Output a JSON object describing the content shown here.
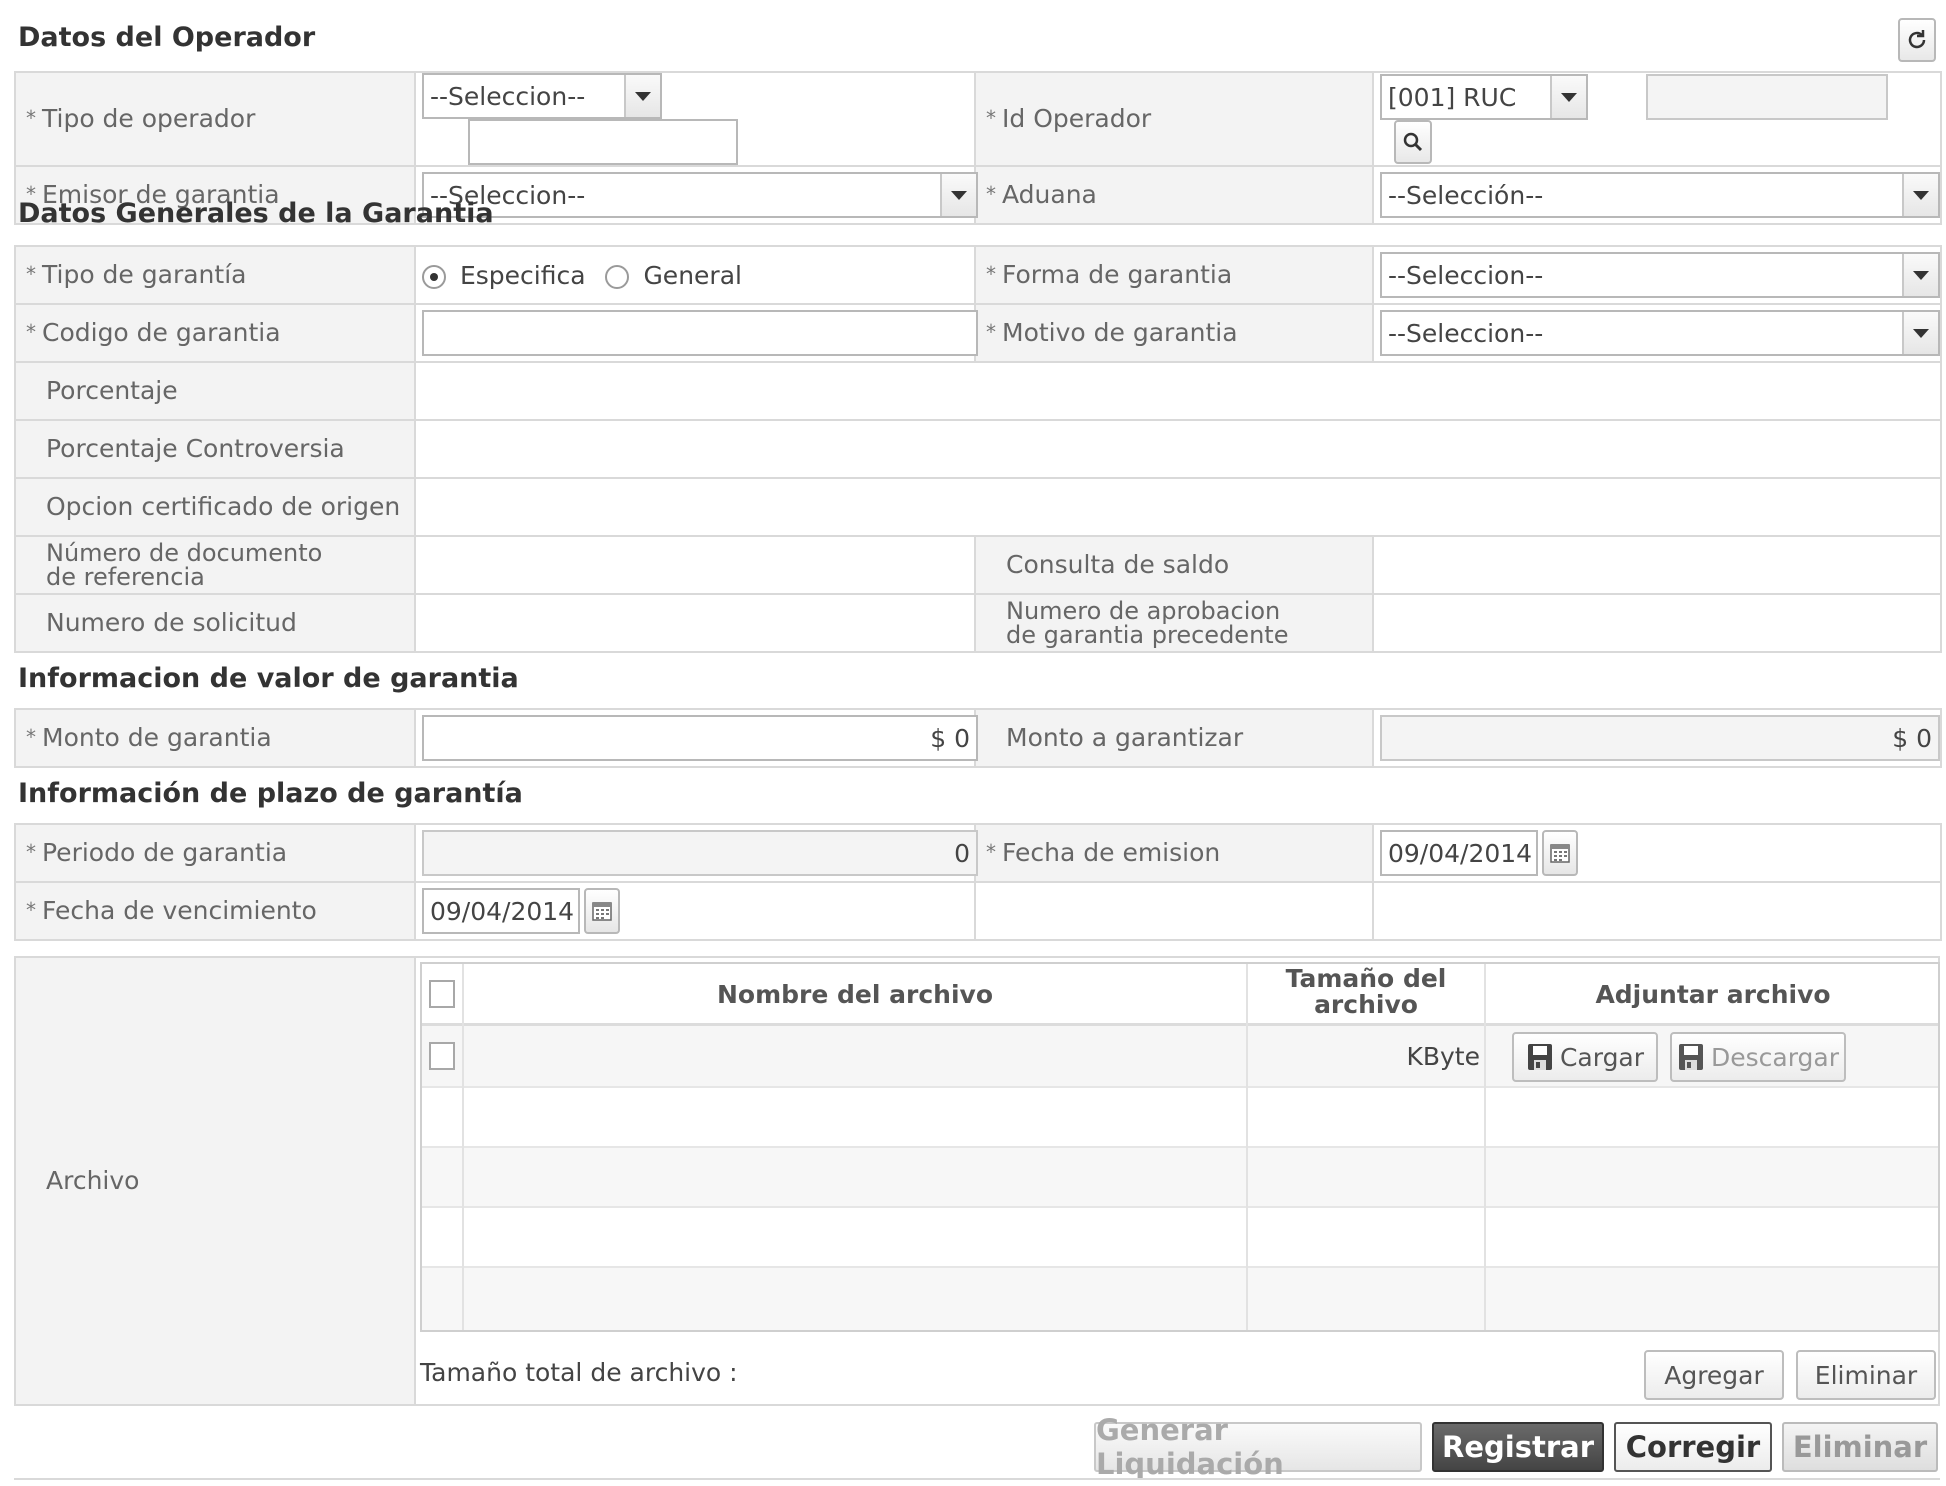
{
  "sections": {
    "operador": "Datos del Operador",
    "generales": "Datos Generales de la Garantia",
    "valor": "Informacion de valor de garantia",
    "plazo": "Información de plazo de garantía"
  },
  "operador": {
    "tipo_operador_label": "Tipo de operador",
    "tipo_operador_value": "--Seleccion--",
    "tipo_operador_text": "",
    "id_operador_label": "Id Operador",
    "id_operador_type": "[001] RUC",
    "id_operador_value": "",
    "emisor_label": "Emisor de garantia",
    "emisor_value": "--Seleccion--",
    "aduana_label": "Aduana",
    "aduana_value": "--Selección--"
  },
  "generales": {
    "tipo_label": "Tipo de garantía",
    "radio_especifica": "Especifica",
    "radio_general": "General",
    "selected_tipo": "Especifica",
    "forma_label": "Forma de garantia",
    "forma_value": "--Seleccion--",
    "codigo_label": "Codigo de garantia",
    "codigo_value": "",
    "motivo_label": "Motivo de garantia",
    "motivo_value": "--Seleccion--",
    "porcentaje_label": "Porcentaje",
    "porcentaje_controversia_label": "Porcentaje Controversia",
    "opcion_certificado_label": "Opcion certificado de origen",
    "numero_documento_label": "Número de documento de referencia",
    "consulta_saldo_label": "Consulta de saldo",
    "numero_solicitud_label": "Numero de solicitud",
    "numero_aprobacion_label": "Numero de aprobacion de garantia precedente"
  },
  "valor": {
    "monto_label": "Monto de garantia",
    "monto_value": "$ 0",
    "monto_garantizar_label": "Monto a garantizar",
    "monto_garantizar_value": "$ 0"
  },
  "plazo": {
    "periodo_label": "Periodo de garantia",
    "periodo_value": "0",
    "fecha_emision_label": "Fecha de emision",
    "fecha_emision_value": "09/04/2014",
    "fecha_vencimiento_label": "Fecha de vencimiento",
    "fecha_vencimiento_value": "09/04/2014"
  },
  "archivo": {
    "label": "Archivo",
    "columns": [
      "Nombre del archivo",
      "Tamaño del archivo",
      "Adjuntar archivo"
    ],
    "row_size_unit": "KByte",
    "cargar": "Cargar",
    "descargar": "Descargar",
    "total_label": "Tamaño total de archivo :",
    "agregar": "Agregar",
    "eliminar": "Eliminar"
  },
  "actions": {
    "generar": "Generar Liquidación",
    "registrar": "Registrar",
    "corregir": "Corregir",
    "eliminar": "Eliminar"
  },
  "colors": {
    "primary_button": "#555555",
    "label_background": "#f3f3f3",
    "border": "#d9d9d9"
  }
}
